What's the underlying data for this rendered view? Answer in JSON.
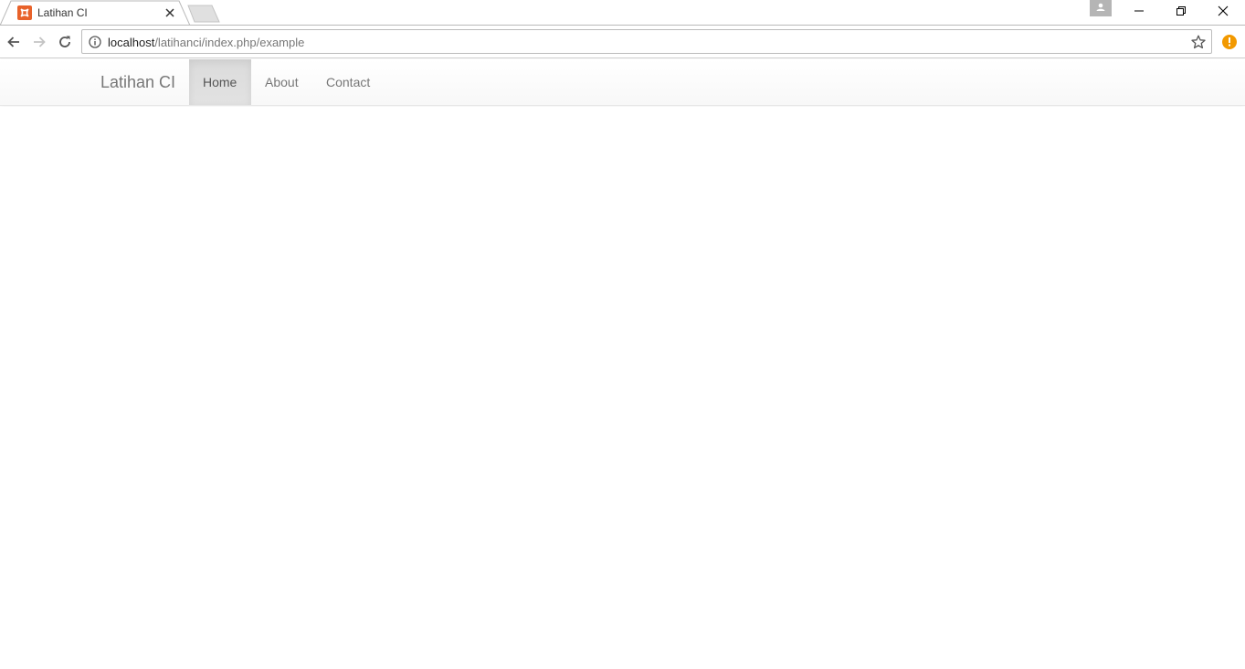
{
  "browser": {
    "tab": {
      "title": "Latihan CI"
    },
    "address_bar": {
      "host": "localhost",
      "path": "/latihanci/index.php/example"
    },
    "colors": {
      "favicon": "#e8622a",
      "alert": "#f29900"
    }
  },
  "page": {
    "navbar": {
      "brand": "Latihan CI",
      "items": [
        {
          "label": "Home",
          "active": true
        },
        {
          "label": "About",
          "active": false
        },
        {
          "label": "Contact",
          "active": false
        }
      ]
    }
  }
}
